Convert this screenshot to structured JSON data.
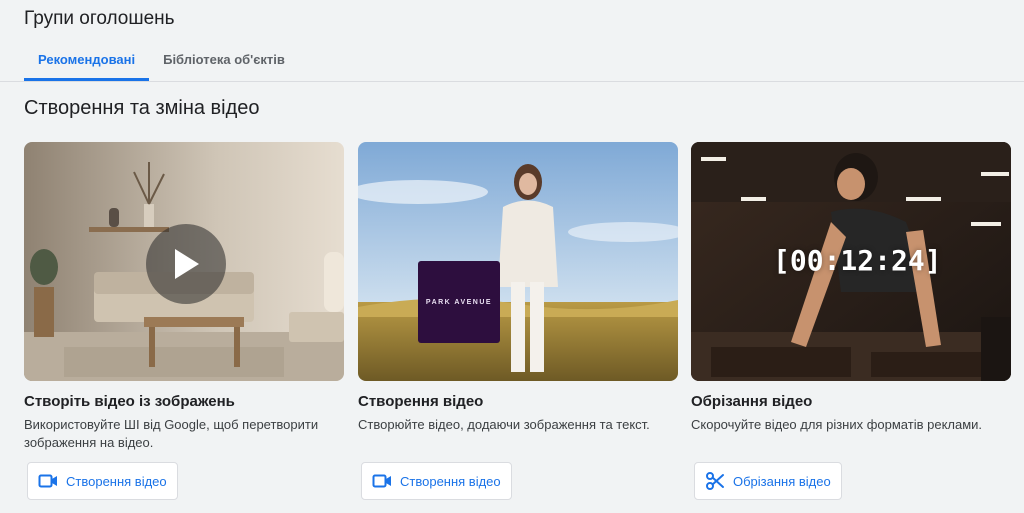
{
  "header": {
    "title": "Групи оголошень",
    "tabs": [
      {
        "label": "Рекомендовані",
        "active": true
      },
      {
        "label": "Бібліотека об'єктів",
        "active": false
      }
    ]
  },
  "section": {
    "title": "Створення та зміна відео"
  },
  "cards": [
    {
      "title": "Створіть відео із зображень",
      "description": "Використовуйте ШІ від Google, щоб перетворити зображення на відео.",
      "button_label": "Створення відео",
      "button_icon": "videocam-icon",
      "thumbnail": "living-room-with-play-icon"
    },
    {
      "title": "Створення відео",
      "description": "Створюйте відео, додаючи зображення та текст.",
      "button_label": "Створення відео",
      "button_icon": "videocam-icon",
      "thumbnail": "woman-in-field",
      "badge_text": "PARK AVENUE"
    },
    {
      "title": "Обрізання відео",
      "description": "Скорочуйте відео для різних форматів реклами.",
      "button_label": "Обрізання відео",
      "button_icon": "scissors-icon",
      "thumbnail": "woman-workout-gym",
      "timer_text": "[00:12:24]"
    }
  ],
  "colors": {
    "accent": "#1a73e8",
    "background": "#f1f3f4"
  }
}
